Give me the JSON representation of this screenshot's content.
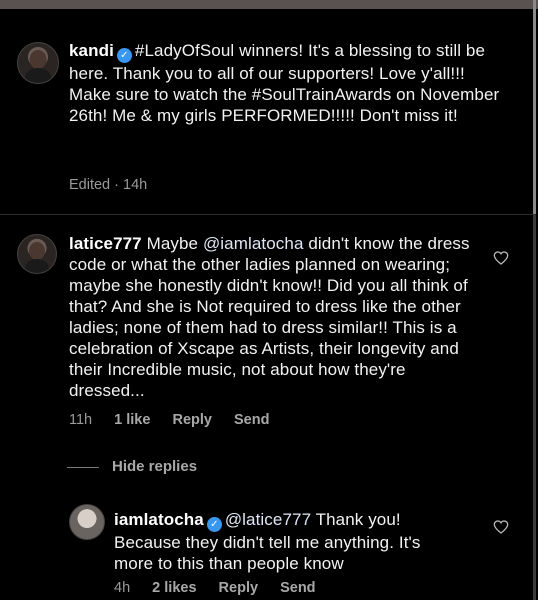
{
  "comments": [
    {
      "username": "kandi",
      "verified": true,
      "lines": [
        "#LadyOfSoul winners! It's a blessing to still be here. Thank you to all of our supporters! Love y'all!!!",
        "Make sure to watch the #SoulTrainAwards on November 26th! Me & my girls PERFORMED!!!!! Don't miss it!"
      ],
      "meta": "Edited · 14h"
    },
    {
      "username": "latice777",
      "verified": false,
      "mention": "@iamlatocha",
      "text_before": "Maybe ",
      "text_after": " didn't know the dress code or what the other ladies planned on wearing; maybe she honestly didn't know!! Did you all think of that? And she is Not required to dress like the other ladies; none of them had to dress similar!! This is a celebration of Xscape as Artists, their longevity and their Incredible music, not about how they're dressed...",
      "time": "11h",
      "likes": "1 like",
      "reply": "Reply",
      "send": "Send"
    }
  ],
  "hide_replies": "Hide replies",
  "reply_comment": {
    "username": "iamlatocha",
    "verified": true,
    "mention": "@latice777",
    "text": " Thank you! Because they didn't tell me anything. It's more to this than people know",
    "time": "4h",
    "likes": "2 likes",
    "reply": "Reply",
    "send": "Send"
  },
  "icons": [
    "heart-icon",
    "verified-icon"
  ],
  "colors": {
    "background": "#000000",
    "verified": "#3897f0",
    "muted": "#9a9a9a"
  }
}
